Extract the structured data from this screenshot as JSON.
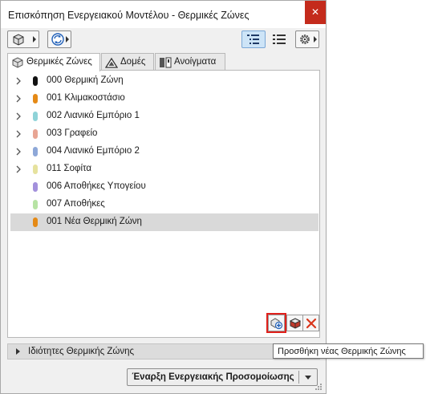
{
  "window": {
    "title": "Επισκόπηση Ενεργειακού Μοντέλου - Θερμικές Ζώνες",
    "close_glyph": "✕"
  },
  "toolbar": {
    "buttons": [
      {
        "icon": "3d-view-icon"
      },
      {
        "icon": "refresh-icon",
        "active": false
      },
      {
        "icon": "tree-view-icon",
        "active": true
      },
      {
        "icon": "list-view-icon",
        "active": false
      },
      {
        "icon": "settings-gear-icon"
      }
    ]
  },
  "tabs": [
    {
      "label": "Θερμικές Ζώνες",
      "icon": "thermal-zones-icon",
      "selected": true
    },
    {
      "label": "Δομές",
      "icon": "structures-icon",
      "selected": false
    },
    {
      "label": "Ανοίγματα",
      "icon": "openings-icon",
      "selected": false
    }
  ],
  "zones": [
    {
      "label": "000 Θερμική Ζώνη",
      "color": "#111111",
      "expandable": true,
      "selected": false
    },
    {
      "label": "001 Κλιμακοστάσιο",
      "color": "#e58a16",
      "expandable": true,
      "selected": false
    },
    {
      "label": "002 Λιανικό Εμπόριο 1",
      "color": "#8fd3d8",
      "expandable": true,
      "selected": false
    },
    {
      "label": "003 Γραφείο",
      "color": "#e8a594",
      "expandable": true,
      "selected": false
    },
    {
      "label": "004 Λιανικό Εμπόριο 2",
      "color": "#8ea8d8",
      "expandable": true,
      "selected": false
    },
    {
      "label": "011 Σοφίτα",
      "color": "#e6e29e",
      "expandable": true,
      "selected": false
    },
    {
      "label": "006 Αποθήκες Υπογείου",
      "color": "#a391dc",
      "expandable": false,
      "selected": false
    },
    {
      "label": "007 Αποθήκες",
      "color": "#b7e3a4",
      "expandable": false,
      "selected": false
    },
    {
      "label": "001 Νέα Θερμική Ζώνη",
      "color": "#e58a16",
      "expandable": false,
      "selected": true
    }
  ],
  "panel_actions": [
    {
      "name": "add-thermal-zone",
      "icon": "add-zone-icon",
      "highlight": true
    },
    {
      "name": "duplicate-thermal-zone",
      "icon": "cube-icon",
      "highlight": false
    },
    {
      "name": "delete-thermal-zone",
      "icon": "delete-x-icon",
      "highlight": false,
      "color": "#d9361c"
    }
  ],
  "properties": {
    "label": "Ιδιότητες Θερμικής Ζώνης"
  },
  "simulation": {
    "label": "Έναρξη Ενεργειακής Προσομοίωσης"
  },
  "tooltip": {
    "text": "Προσθήκη νέας Θερμικής Ζώνης"
  },
  "colors": {
    "selection": "#d9d9d9",
    "highlight_border": "#e0201b",
    "close_bg": "#c42b1c",
    "active_toggle": "#cde4f7"
  }
}
